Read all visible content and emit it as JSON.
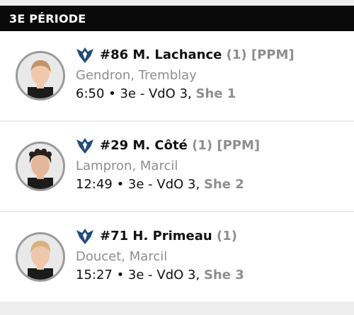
{
  "period": {
    "title": "3E PÉRIODE"
  },
  "goals": [
    {
      "number_name": "#86 M. Lachance",
      "goal_tag": "(1) [PPM]",
      "assists": "Gendron, Tremblay",
      "time_detail": "6:50 • 3e - VdO 3, ",
      "ordinal": "She 1",
      "avatar": {
        "hair": "#c29566",
        "skin": "#f0c9ad"
      }
    },
    {
      "number_name": "#29 M. Côté",
      "goal_tag": "(1) [PPM]",
      "assists": "Lampron, Marcil",
      "time_detail": "12:49 • 3e - VdO 3, ",
      "ordinal": "She 2",
      "avatar": {
        "hair": "#2a1f19",
        "skin": "#e3b79a"
      }
    },
    {
      "number_name": "#71 H. Primeau",
      "goal_tag": "(1)",
      "assists": "Doucet, Marcil",
      "time_detail": "15:27 • 3e - VdO 3, ",
      "ordinal": "She 3",
      "avatar": {
        "hair": "#d8b27a",
        "skin": "#efc7aa"
      }
    }
  ],
  "colors": {
    "header_bg": "#0a0a0a",
    "team_logo": "#1f4b7a",
    "muted": "#8e8e8e"
  },
  "icons": {
    "team_logo": "team-logo-icon"
  }
}
